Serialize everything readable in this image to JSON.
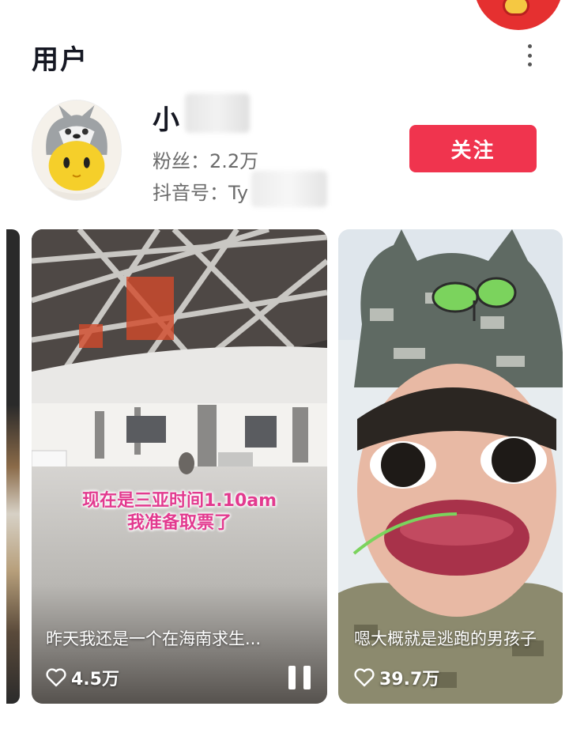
{
  "header": {
    "title": "用户"
  },
  "user": {
    "name": "小",
    "followers": "粉丝：2.2万",
    "douyin_id": "抖音号：Ty",
    "follow_label": "关注"
  },
  "videos": [
    {
      "overlay_line1": "现在是三亚时间1.10am",
      "overlay_line2": "我准备取票了",
      "title": "昨天我还是一个在海南求生...",
      "likes": "4.5万"
    },
    {
      "title": "嗯大概就是逃跑的男孩子",
      "likes": "39.7万"
    }
  ],
  "icons": [
    "more-icon",
    "heart-icon",
    "pause-icon"
  ],
  "colors": {
    "follow_button": "#f0344e",
    "sticker_text": "#e23a8f"
  }
}
